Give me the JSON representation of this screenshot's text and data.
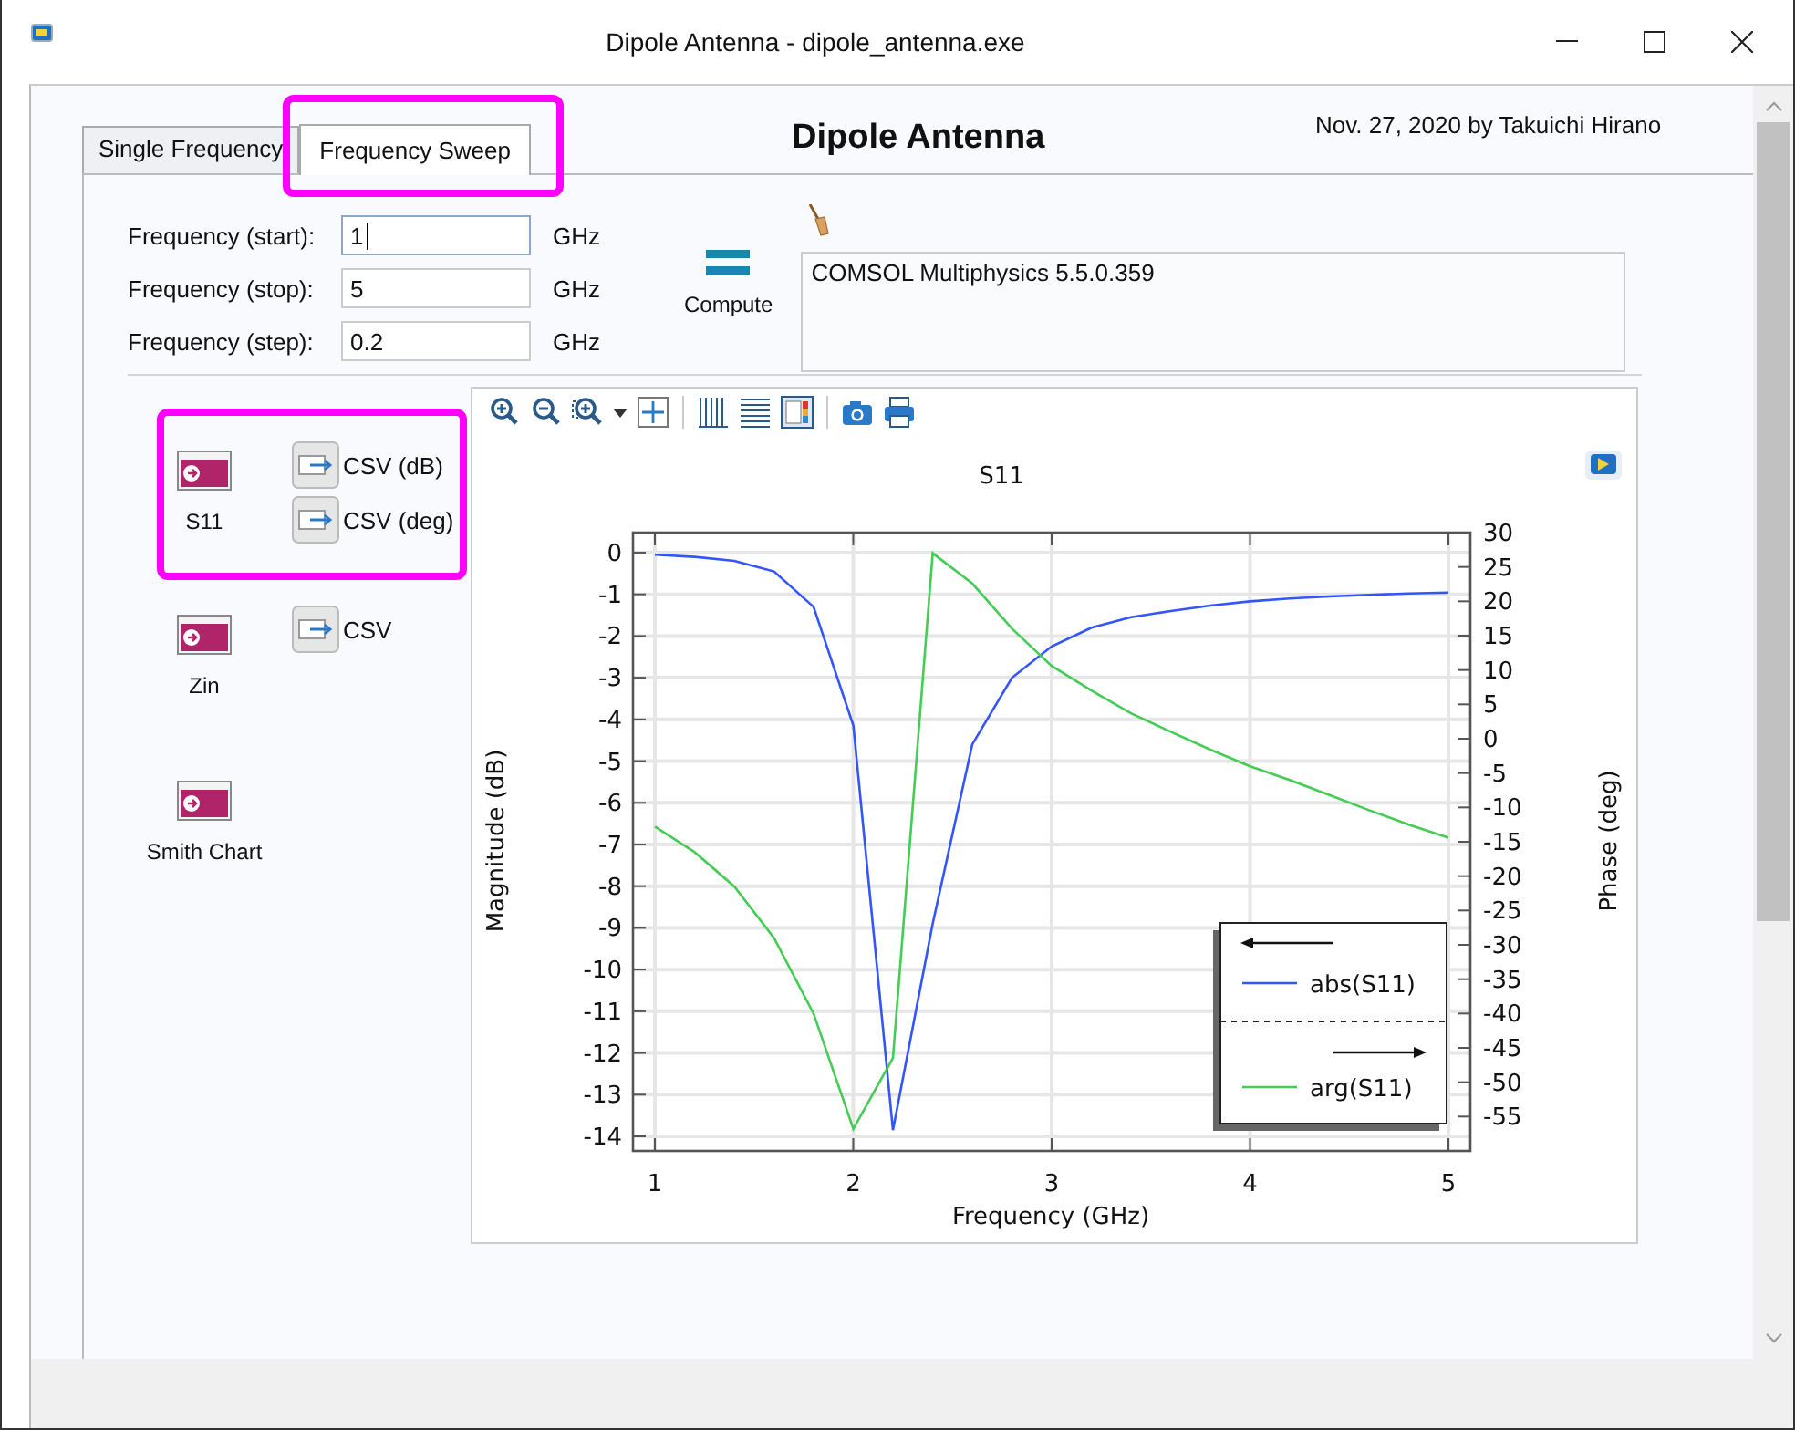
{
  "window": {
    "title": "Dipole Antenna - dipole_antenna.exe"
  },
  "tabs": [
    {
      "label": "Single Frequency",
      "selected": false,
      "highlighted": false
    },
    {
      "label": "Frequency Sweep",
      "selected": true,
      "highlighted": true
    }
  ],
  "heading": "Dipole Antenna",
  "credit": "Nov. 27, 2020 by Takuichi Hirano",
  "inputs": [
    {
      "label": "Frequency (start):",
      "value": "1",
      "unit": "GHz",
      "focused": true
    },
    {
      "label": "Frequency (stop):",
      "value": "5",
      "unit": "GHz",
      "focused": false
    },
    {
      "label": "Frequency (step):",
      "value": "0.2",
      "unit": "GHz",
      "focused": false
    }
  ],
  "compute_button": {
    "label": "Compute"
  },
  "log": {
    "text": "COMSOL Multiphysics 5.5.0.359"
  },
  "plot_groups": [
    {
      "plot": "S11",
      "exports": [
        "CSV (dB)",
        "CSV (deg)"
      ],
      "highlighted": true
    },
    {
      "plot": "Zin",
      "exports": [
        "CSV"
      ],
      "highlighted": false
    },
    {
      "plot": "Smith Chart",
      "highlighted": false
    }
  ],
  "graph": {
    "chart_data": {
      "type": "line",
      "title": "S11",
      "xlabel": "Frequency (GHz)",
      "ylabel": "Magnitude (dB)",
      "y2label": "Phase (deg)",
      "y2lim": [
        -60,
        30
      ],
      "y2ticks": [
        30,
        25,
        20,
        15,
        10,
        5,
        0,
        -5,
        -10,
        -15,
        -20,
        -25,
        -30,
        -35,
        -40,
        -45,
        -50,
        -55
      ],
      "x": [
        1,
        1.2,
        1.4,
        1.6,
        1.8,
        2,
        2.2,
        2.4,
        2.6,
        2.8,
        3,
        3.2,
        3.4,
        3.6,
        3.8,
        4,
        4.2,
        4.4,
        4.6,
        4.8,
        5
      ],
      "series": [
        {
          "name": "abs(S11)",
          "color": "#3355ff",
          "values": [
            -0.05,
            -0.1,
            -0.2,
            -0.45,
            -1.3,
            -4.15,
            -13.85,
            -8.9,
            -4.6,
            -3.0,
            -2.25,
            -1.8,
            -1.55,
            -1.4,
            -1.27,
            -1.17,
            -1.1,
            -1.05,
            -1.01,
            -0.98,
            -0.96
          ]
        },
        {
          "name": "arg(S11)",
          "color": "#44cc55",
          "axis": "y2",
          "values": [
            -12.8,
            -16.5,
            -21.5,
            -29,
            -40,
            -56.8,
            -46.5,
            27,
            22.6,
            16,
            10.6,
            7,
            3.7,
            1,
            -1.6,
            -4,
            -6,
            -8.2,
            -10.4,
            -12.5,
            -14.4
          ]
        }
      ],
      "grid": true,
      "legend": true,
      "xlim": [
        1,
        5
      ],
      "ylim": [
        -14.35,
        0.48
      ],
      "xticks": [
        1,
        2,
        3,
        4,
        5
      ],
      "yticks": [
        0,
        -1,
        -2,
        -3,
        -4,
        -5,
        -6,
        -7,
        -8,
        -9,
        -10,
        -11,
        -12,
        -13,
        -14
      ]
    }
  }
}
